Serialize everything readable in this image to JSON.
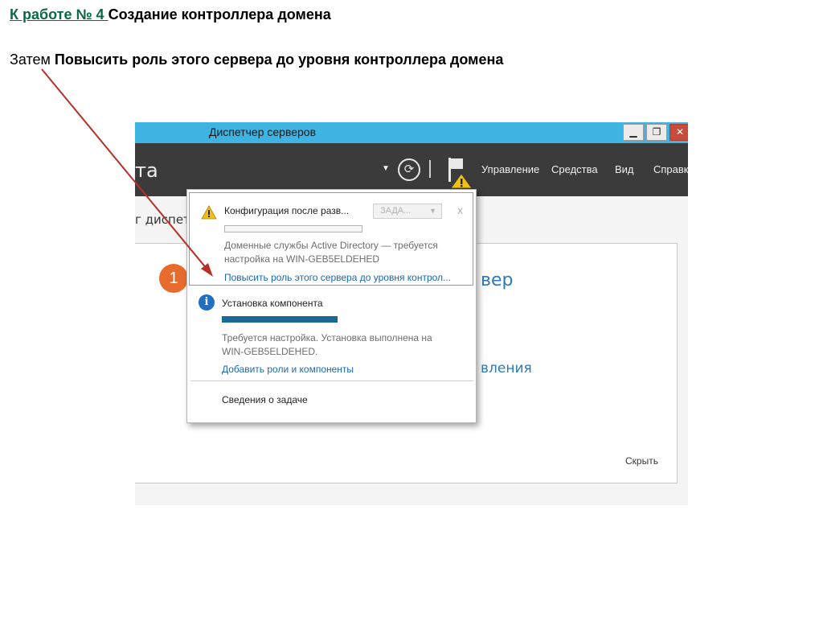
{
  "slide": {
    "link_text": "К работе № 4 ",
    "heading_rest": "Создание контроллера домена",
    "line2_prefix": "Затем ",
    "line2_bold": "Повысить роль этого сервера до уровня контроллера домена"
  },
  "window": {
    "title": "Диспетчер серверов",
    "buttons": {
      "minimize": "▁",
      "restore": "❐",
      "close": "✕"
    }
  },
  "toolbar": {
    "title_fragment": "та",
    "menus": [
      "Управление",
      "Средства",
      "Вид",
      "Справк"
    ],
    "icons": [
      "dropdown-caret-icon",
      "refresh-icon",
      "notifications-flag-icon",
      "warning-icon"
    ]
  },
  "page": {
    "breadcrumb_fragment": "г диспетч",
    "step_badge": "1",
    "bg_text_1": "вер",
    "bg_text_2": "вления",
    "hide_label": "Скрыть"
  },
  "notifications": {
    "item1": {
      "icon": "warning-icon",
      "title": "Конфигурация после разв...",
      "tasks_label": "ЗАДА...",
      "close": "x",
      "desc_line1": "Доменные службы Active Directory — требуется",
      "desc_line2": "настройка на WIN-GEB5ELDEHED",
      "link": "Повысить роль этого сервера до уровня контрол..."
    },
    "item2": {
      "icon": "info-icon",
      "title": "Установка компонента",
      "desc_line1": "Требуется настройка. Установка выполнена на",
      "desc_line2": "WIN-GEB5ELDEHED.",
      "link": "Добавить роли и компоненты"
    },
    "task_details": "Сведения о задаче"
  },
  "colors": {
    "title_bar": "#3fb4e3",
    "toolbar": "#3b3b3b",
    "link": "#1b68b1",
    "progress": "#1b6a93",
    "badge": "#e86b2e",
    "arrow": "#b5302a",
    "heading_link": "#0a6a45"
  }
}
